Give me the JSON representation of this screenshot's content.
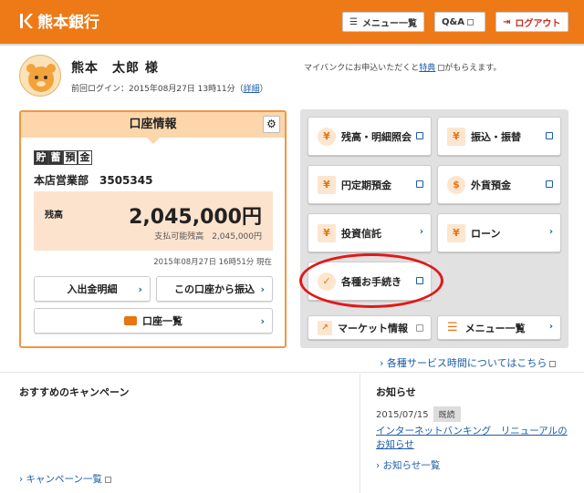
{
  "header": {
    "bank_name": "熊本銀行",
    "menu_label": "メニュー一覧",
    "qa_label": "Q&A",
    "logout_label": "ログアウト",
    "brand_color": "#ee7a17"
  },
  "user": {
    "name": "熊本　太郎 様",
    "last_login_prefix": "前回ログイン：2015年08月27日 13時11分（",
    "detail_link": "詳細",
    "last_login_suffix": "）"
  },
  "mypage": {
    "text_before": "マイバンクにお申込いただくと",
    "link": "特典",
    "text_after": "がもらえます。"
  },
  "account": {
    "title": "口座情報",
    "type_chars": [
      "貯",
      "蓄",
      "預",
      "金"
    ],
    "branch_number": "本店営業部　3505345",
    "balance_label": "残高",
    "balance_value": "2,045,000円",
    "available_label": "支払可能残高　2,045,000円",
    "timestamp": "2015年08月27日 16時51分 現在",
    "btn_statement": "入出金明細",
    "btn_transfer": "この口座から振込",
    "btn_list": "口座一覧"
  },
  "services": {
    "balance_inquiry": "残高・明細照会",
    "transfer": "振込・振替",
    "time_deposit": "円定期預金",
    "foreign_deposit": "外貨預金",
    "investment": "投資信託",
    "loan": "ローン",
    "procedures": "各種お手続き",
    "market": "マーケット情報",
    "menu_list": "メニュー一覧"
  },
  "service_hours_link": "各種サービス時間についてはこちら",
  "campaign": {
    "heading": "おすすめのキャンペーン",
    "list_link": "キャンペーン一覧"
  },
  "news": {
    "heading": "お知らせ",
    "date": "2015/07/15",
    "read_badge": "既読",
    "title": "インターネットバンキング　リニューアルのお知らせ",
    "list_link": "お知らせ一覧"
  },
  "icons": {
    "logo": "bank-logo-icon",
    "menu": "hamburger-icon",
    "logout": "logout-icon",
    "settings": "gear-icon"
  },
  "colors": {
    "highlight_ring": "#e21818",
    "link": "#1a5ca8"
  }
}
